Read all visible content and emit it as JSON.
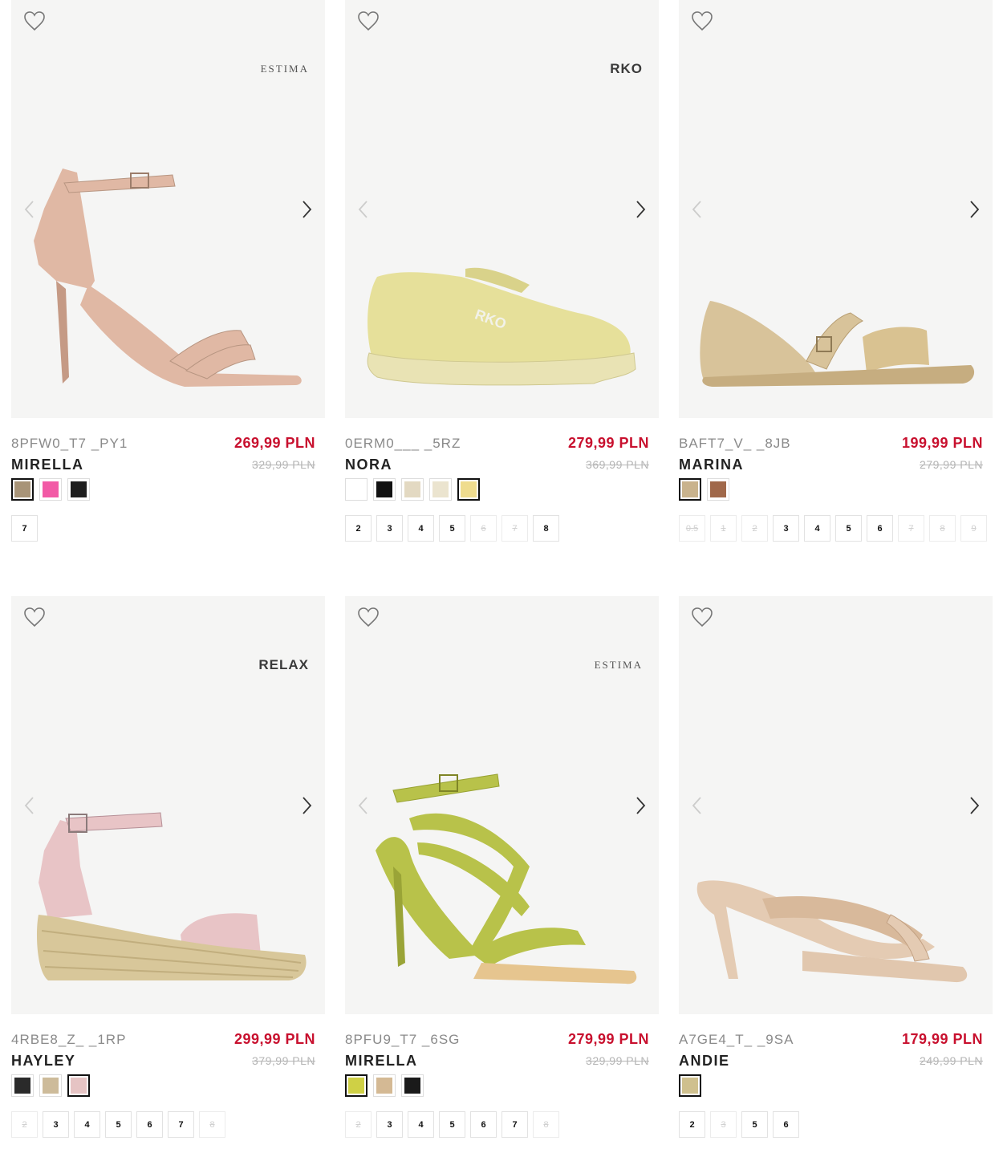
{
  "products": [
    {
      "sku": "8PFW0_T7 _PY1",
      "name": "MIRELLA",
      "price": "269,99 PLN",
      "old_price": "329,99 PLN",
      "brand": "ESTIMA",
      "brand_style": "serif",
      "shoe_icon": "heeled-sandal-icon",
      "shoe_color": "#e0b8a4",
      "swatches": [
        {
          "color": "#a89478",
          "selected": true
        },
        {
          "color": "#f25aa6",
          "selected": false
        },
        {
          "color": "#1e1e1e",
          "selected": false
        }
      ],
      "sizes": [
        {
          "label": "7",
          "available": true
        }
      ]
    },
    {
      "sku": "0ERM0___ _5RZ",
      "name": "NORA",
      "price": "279,99 PLN",
      "old_price": "369,99 PLN",
      "brand": "RKO",
      "brand_style": "bold",
      "shoe_icon": "sneaker-icon",
      "shoe_color": "#e6e09a",
      "swatches": [
        {
          "color": "#ffffff",
          "selected": false
        },
        {
          "color": "#111111",
          "selected": false
        },
        {
          "color": "#e3d9c2",
          "selected": false
        },
        {
          "color": "#ebe4cf",
          "selected": false
        },
        {
          "color": "#efdc8e",
          "selected": true
        }
      ],
      "sizes": [
        {
          "label": "2",
          "available": true
        },
        {
          "label": "3",
          "available": true
        },
        {
          "label": "4",
          "available": true
        },
        {
          "label": "5",
          "available": true
        },
        {
          "label": "6",
          "available": false
        },
        {
          "label": "7",
          "available": false
        },
        {
          "label": "8",
          "available": true
        }
      ]
    },
    {
      "sku": "BAFT7_V_ _8JB",
      "name": "MARINA",
      "price": "199,99 PLN",
      "old_price": "279,99 PLN",
      "brand": "",
      "brand_style": "serif",
      "shoe_icon": "flat-sandal-icon",
      "shoe_color": "#d8c39a",
      "swatches": [
        {
          "color": "#c9b38d",
          "selected": true
        },
        {
          "color": "#a0684a",
          "selected": false
        }
      ],
      "sizes": [
        {
          "label": "0.5",
          "available": false
        },
        {
          "label": "1",
          "available": false
        },
        {
          "label": "2",
          "available": false
        },
        {
          "label": "3",
          "available": true
        },
        {
          "label": "4",
          "available": true
        },
        {
          "label": "5",
          "available": true
        },
        {
          "label": "6",
          "available": true
        },
        {
          "label": "7",
          "available": false
        },
        {
          "label": "8",
          "available": false
        },
        {
          "label": "9",
          "available": false
        }
      ]
    },
    {
      "sku": "4RBE8_Z_ _1RP",
      "name": "HAYLEY",
      "price": "299,99 PLN",
      "old_price": "379,99 PLN",
      "brand": "RELAX",
      "brand_style": "bold",
      "shoe_icon": "wedge-sandal-icon",
      "shoe_color": "#e8c4c6",
      "swatches": [
        {
          "color": "#2a2a2a",
          "selected": false
        },
        {
          "color": "#cdbb9a",
          "selected": false
        },
        {
          "color": "#e6c4c4",
          "selected": true
        }
      ],
      "sizes": [
        {
          "label": "2",
          "available": false
        },
        {
          "label": "3",
          "available": true
        },
        {
          "label": "4",
          "available": true
        },
        {
          "label": "5",
          "available": true
        },
        {
          "label": "6",
          "available": true
        },
        {
          "label": "7",
          "available": true
        },
        {
          "label": "8",
          "available": false
        }
      ]
    },
    {
      "sku": "8PFU9_T7 _6SG",
      "name": "MIRELLA",
      "price": "279,99 PLN",
      "old_price": "329,99 PLN",
      "brand": "ESTIMA",
      "brand_style": "serif",
      "shoe_icon": "strappy-heel-icon",
      "shoe_color": "#b8c24a",
      "swatches": [
        {
          "color": "#cfd045",
          "selected": true
        },
        {
          "color": "#d4b994",
          "selected": false
        },
        {
          "color": "#1a1a1a",
          "selected": false
        }
      ],
      "sizes": [
        {
          "label": "2",
          "available": false
        },
        {
          "label": "3",
          "available": true
        },
        {
          "label": "4",
          "available": true
        },
        {
          "label": "5",
          "available": true
        },
        {
          "label": "6",
          "available": true
        },
        {
          "label": "7",
          "available": true
        },
        {
          "label": "8",
          "available": false
        }
      ]
    },
    {
      "sku": "A7GE4_T_ _9SA",
      "name": "ANDIE",
      "price": "179,99 PLN",
      "old_price": "249,99 PLN",
      "brand": "",
      "brand_style": "serif",
      "shoe_icon": "mule-sandal-icon",
      "shoe_color": "#e4cbb3",
      "swatches": [
        {
          "color": "#cfc08e",
          "selected": true
        }
      ],
      "sizes": [
        {
          "label": "2",
          "available": true
        },
        {
          "label": "3",
          "available": false
        },
        {
          "label": "5",
          "available": true
        },
        {
          "label": "6",
          "available": true
        }
      ]
    }
  ]
}
